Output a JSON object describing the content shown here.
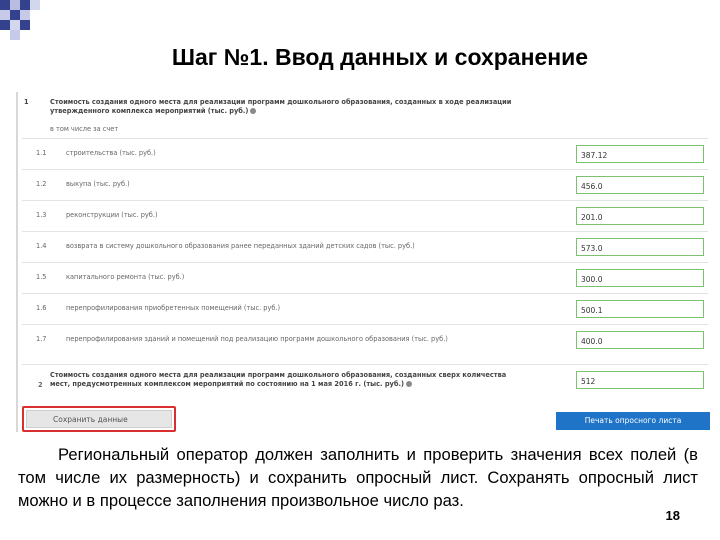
{
  "slide": {
    "title": "Шаг №1. Ввод данных и сохранение",
    "caption": "Региональный оператор должен заполнить и проверить значения всех полей (в том числе их размерность) и сохранить опросный лист. Сохранять опросный лист можно и в процессе заполнения произвольное число раз.",
    "page_number": "18"
  },
  "form": {
    "section1": {
      "num": "1",
      "title": "Стоимость создания одного места для реализации программ дошкольного образования, созданных в ходе реализации утвержденного комплекса мероприятий (тыс. руб.)",
      "subtitle": "в том числе за счет"
    },
    "rows": [
      {
        "num": "1.1",
        "label": "строительства (тыс. руб.)",
        "value": "387.12"
      },
      {
        "num": "1.2",
        "label": "выкупа (тыс. руб.)",
        "value": "456.0"
      },
      {
        "num": "1.3",
        "label": "реконструкции (тыс. руб.)",
        "value": "201.0"
      },
      {
        "num": "1.4",
        "label": "возврата в систему дошкольного образования ранее переданных зданий детских садов (тыс. руб.)",
        "value": "573.0"
      },
      {
        "num": "1.5",
        "label": "капитального ремонта (тыс. руб.)",
        "value": "300.0"
      },
      {
        "num": "1.6",
        "label": "перепрофилирования приобретенных помещений (тыс. руб.)",
        "value": "500.1"
      },
      {
        "num": "1.7",
        "label": "перепрофилирования зданий и помещений под реализацию программ дошкольного образования (тыс. руб.)",
        "value": "400.0"
      }
    ],
    "section2": {
      "num": "2",
      "title": "Стоимость создания одного места для реализации программ дошкольного образования, созданных сверх количества мест, предусмотренных комплексом мероприятий по состоянию на 1 мая 2016 г. (тыс. руб.)",
      "value": "512"
    },
    "save_button_label": "Сохранить данные",
    "print_button_label": "Печать опросного листа"
  },
  "colors": {
    "accent_blue": "#1f74c8",
    "highlight_red": "#d9302f",
    "field_border_green": "#7cc26e",
    "deco_blue": "#34418c"
  }
}
